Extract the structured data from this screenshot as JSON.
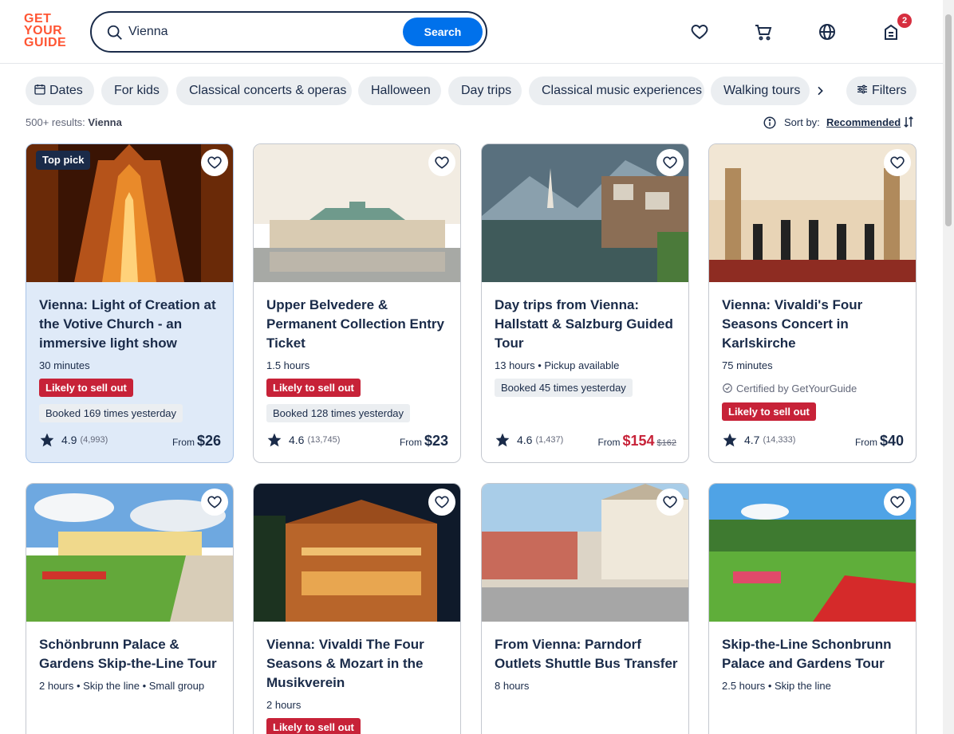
{
  "header": {
    "logo_lines": [
      "GET",
      "YOUR",
      "GUIDE"
    ],
    "search_value": "Vienna",
    "search_button": "Search",
    "cart_count": "2"
  },
  "chips": [
    "Dates",
    "For kids",
    "Classical concerts & operas",
    "Halloween",
    "Day trips",
    "Classical music experiences",
    "Walking tours"
  ],
  "filters_label": "Filters",
  "results": {
    "count": "500+ results:",
    "query": "Vienna"
  },
  "sort": {
    "label": "Sort by:",
    "value": "Recommended"
  },
  "cards": [
    {
      "badge": "Top pick",
      "title": "Vienna: Light of Creation at the Votive Church - an immersive light show",
      "meta": "30 minutes",
      "sell": "Likely to sell out",
      "booked": "Booked 169 times yesterday",
      "rating": "4.9",
      "reviews": "(4,993)",
      "price_from": "From",
      "price": "$26"
    },
    {
      "title": "Upper Belvedere & Permanent Collection Entry Ticket",
      "meta": "1.5 hours",
      "sell": "Likely to sell out",
      "booked": "Booked 128 times yesterday",
      "rating": "4.6",
      "reviews": "(13,745)",
      "price_from": "From",
      "price": "$23"
    },
    {
      "title": "Day trips from Vienna: Hallstatt & Salzburg Guided Tour",
      "meta": "13 hours • Pickup available",
      "booked": "Booked 45 times yesterday",
      "rating": "4.6",
      "reviews": "(1,437)",
      "price_from": "From",
      "price": "$154",
      "old_price": "$162"
    },
    {
      "title": "Vienna: Vivaldi's Four Seasons Concert in Karlskirche",
      "meta": "75 minutes",
      "certified": "Certified by GetYourGuide",
      "sell": "Likely to sell out",
      "rating": "4.7",
      "reviews": "(14,333)",
      "price_from": "From",
      "price": "$40"
    },
    {
      "title": "Schönbrunn Palace & Gardens Skip-the-Line Tour",
      "meta": "2 hours • Skip the line • Small group"
    },
    {
      "title": "Vienna: Vivaldi The Four Seasons & Mozart in the Musikverein",
      "meta": "2 hours",
      "sell": "Likely to sell out"
    },
    {
      "title": "From Vienna: Parndorf Outlets Shuttle Bus Transfer",
      "meta": "8 hours"
    },
    {
      "title": "Skip-the-Line Schonbrunn Palace and Gardens Tour",
      "meta": "2.5 hours • Skip the line"
    }
  ],
  "colors": {
    "brand": "#ff5533",
    "primary": "#0071eb",
    "sell_out": "#c72238",
    "text": "#1a2b49"
  }
}
